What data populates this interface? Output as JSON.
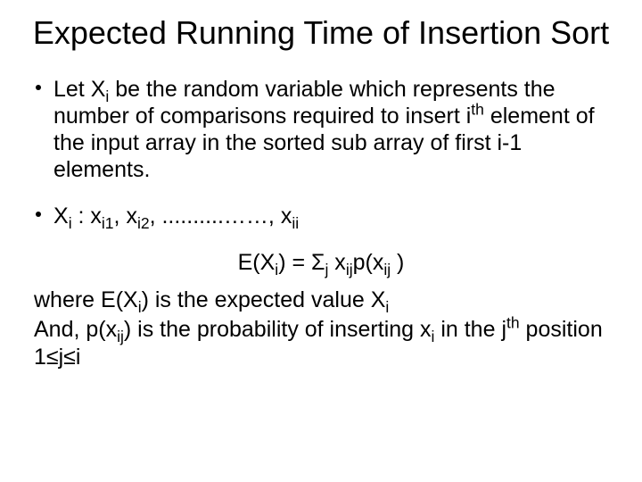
{
  "title": "Expected Running Time of Insertion Sort",
  "bullets": [
    {
      "html": "Let X<sub>i</sub> be the random variable which represents the number of comparisons required to insert i<sup>th</sup> element of the input array in the sorted sub array of first i-1 elements."
    },
    {
      "html": "X<sub>i</sub> : x<sub>i1</sub>, x<sub>i2</sub>, ..........……, x<sub>ii</sub>"
    }
  ],
  "equation_html": "E(X<sub>i</sub>) = Σ<sub>j</sub> x<sub>ij</sub>p(x<sub>ij</sub>  )",
  "where_html": "where E(X<sub>i</sub>) is the expected value X<sub>i</sub>",
  "and_html": "And, p(x<sub>ij</sub>) is the probability of inserting x<sub>i</sub> in the j<sup>th</sup> position 1≤j≤i"
}
